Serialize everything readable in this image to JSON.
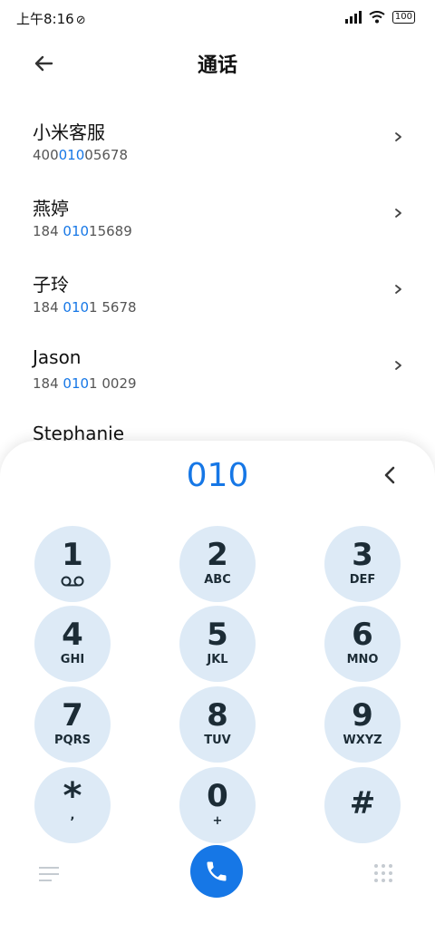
{
  "status_bar": {
    "time": "上午8:16",
    "mute_mark": "🔕",
    "battery": "100"
  },
  "header": {
    "title": "通话"
  },
  "contacts": [
    {
      "name": "小米客服",
      "number_parts": [
        "400",
        "010",
        "05678"
      ]
    },
    {
      "name": "燕婷",
      "number_parts": [
        "184 ",
        "010",
        "15689"
      ]
    },
    {
      "name": "子玲",
      "number_parts": [
        "184 ",
        "010",
        "1 5678"
      ]
    },
    {
      "name": "Jason",
      "number_parts": [
        "184 ",
        "010",
        "1 0029"
      ]
    },
    {
      "name": "Stephanie",
      "number_parts": [
        "",
        "",
        ""
      ]
    }
  ],
  "dialer": {
    "input": "010",
    "keys": [
      {
        "digit": "1",
        "letters": ""
      },
      {
        "digit": "2",
        "letters": "ABC"
      },
      {
        "digit": "3",
        "letters": "DEF"
      },
      {
        "digit": "4",
        "letters": "GHI"
      },
      {
        "digit": "5",
        "letters": "JKL"
      },
      {
        "digit": "6",
        "letters": "MNO"
      },
      {
        "digit": "7",
        "letters": "PQRS"
      },
      {
        "digit": "8",
        "letters": "TUV"
      },
      {
        "digit": "9",
        "letters": "WXYZ"
      },
      {
        "digit": "*",
        "letters": ","
      },
      {
        "digit": "0",
        "letters": "+"
      },
      {
        "digit": "#",
        "letters": ""
      }
    ]
  },
  "colors": {
    "accent": "#1677e6",
    "key_bg": "#ddeaf6",
    "key_text": "#1c2c36"
  },
  "icons": {
    "back": "arrow-left-icon",
    "chevron": "chevron-right-icon",
    "delete": "chevron-left-icon",
    "voicemail": "voicemail-icon",
    "menu": "menu-icon",
    "call": "phone-icon",
    "dialpad": "dialpad-icon"
  }
}
